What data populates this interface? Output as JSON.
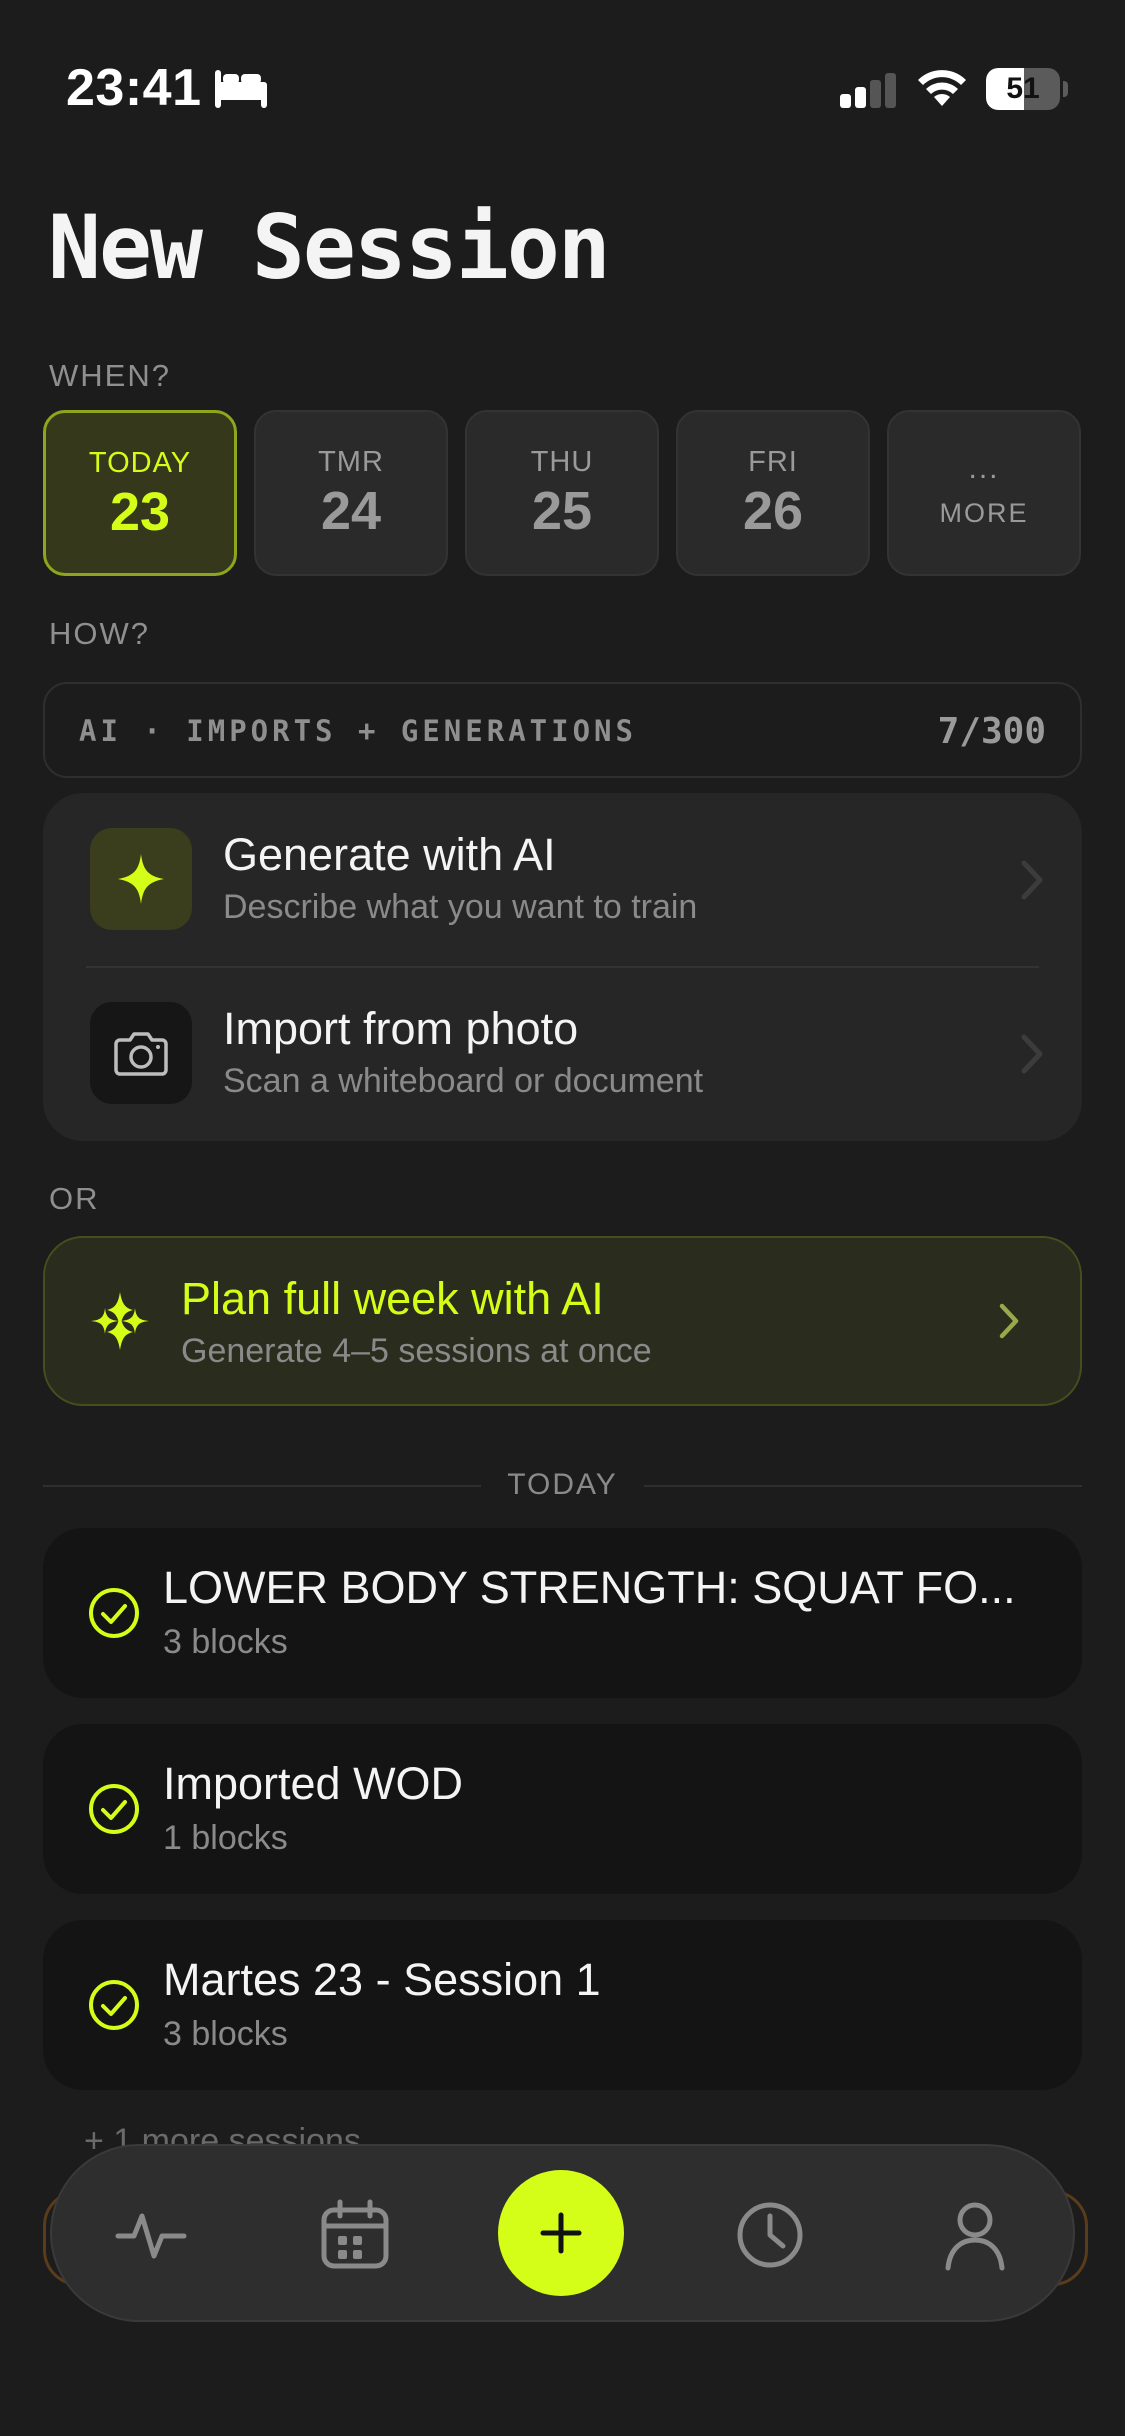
{
  "status_bar": {
    "time": "23:41",
    "battery": "51",
    "battery_level": 0.51,
    "icons": [
      "bed-icon",
      "cellular-signal-icon",
      "wifi-icon",
      "battery-icon"
    ]
  },
  "title": "New Session",
  "when": {
    "label": "WHEN?",
    "days": [
      {
        "day": "TODAY",
        "date": "23",
        "selected": true
      },
      {
        "day": "TMR",
        "date": "24",
        "selected": false
      },
      {
        "day": "THU",
        "date": "25",
        "selected": false
      },
      {
        "day": "FRI",
        "date": "26",
        "selected": false
      }
    ],
    "more": {
      "dots": "...",
      "label": "MORE"
    }
  },
  "how": {
    "label": "HOW?",
    "quota_label": "AI · IMPORTS + GENERATIONS",
    "quota_count": "7/300",
    "actions": [
      {
        "title": "Generate with AI",
        "subtitle": "Describe what you want to train",
        "icon": "sparkle-icon"
      },
      {
        "title": "Import from photo",
        "subtitle": "Scan a whiteboard or document",
        "icon": "camera-icon"
      }
    ]
  },
  "or_label": "OR",
  "plan_week": {
    "title": "Plan full week with AI",
    "subtitle": "Generate 4–5 sessions at once",
    "icon": "multi-sparkle-icon"
  },
  "today": {
    "label": "TODAY",
    "sessions": [
      {
        "title": "LOWER BODY STRENGTH: SQUAT FO...",
        "subtitle": "3 blocks"
      },
      {
        "title": "Imported WOD",
        "subtitle": "1 blocks"
      },
      {
        "title": "Martes 23 - Session 1",
        "subtitle": "3 blocks"
      }
    ],
    "more_sessions": "+ 1 more sessions"
  },
  "tab_bar": {
    "tabs": [
      "activity-icon",
      "calendar-icon",
      "plus-icon",
      "clock-icon",
      "profile-icon"
    ]
  },
  "colors": {
    "accent": "#d4fd17",
    "background": "#1c1c1c",
    "card": "#262626"
  }
}
